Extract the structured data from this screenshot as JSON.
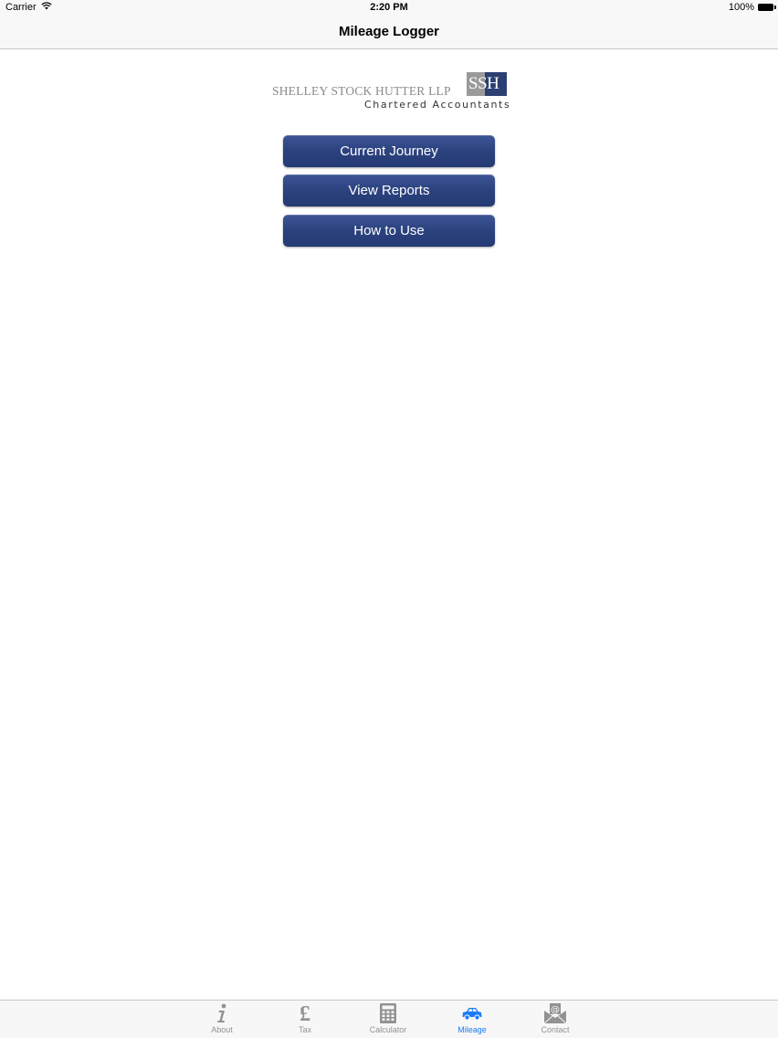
{
  "status_bar": {
    "carrier": "Carrier",
    "time": "2:20 PM",
    "battery": "100%"
  },
  "nav": {
    "title": "Mileage Logger"
  },
  "logo": {
    "name": "SHELLEY STOCK HUTTER LLP",
    "badge": "SSH",
    "subtitle": "Chartered Accountants",
    "badge_colors": {
      "back": "#9a9a9a",
      "front": "#2b3f73"
    }
  },
  "menu": {
    "buttons": [
      {
        "label": "Current Journey"
      },
      {
        "label": "View Reports"
      },
      {
        "label": "How to Use"
      }
    ],
    "button_color": "#2c427f"
  },
  "tabs": [
    {
      "label": "About",
      "icon": "info-icon",
      "active": false
    },
    {
      "label": "Tax",
      "icon": "pound-icon",
      "active": false
    },
    {
      "label": "Calculator",
      "icon": "calculator-icon",
      "active": false
    },
    {
      "label": "Mileage",
      "icon": "car-icon",
      "active": true
    },
    {
      "label": "Contact",
      "icon": "envelope-at-icon",
      "active": false
    }
  ],
  "colors": {
    "tab_active": "#1a7cf5",
    "tab_inactive": "#929292"
  }
}
